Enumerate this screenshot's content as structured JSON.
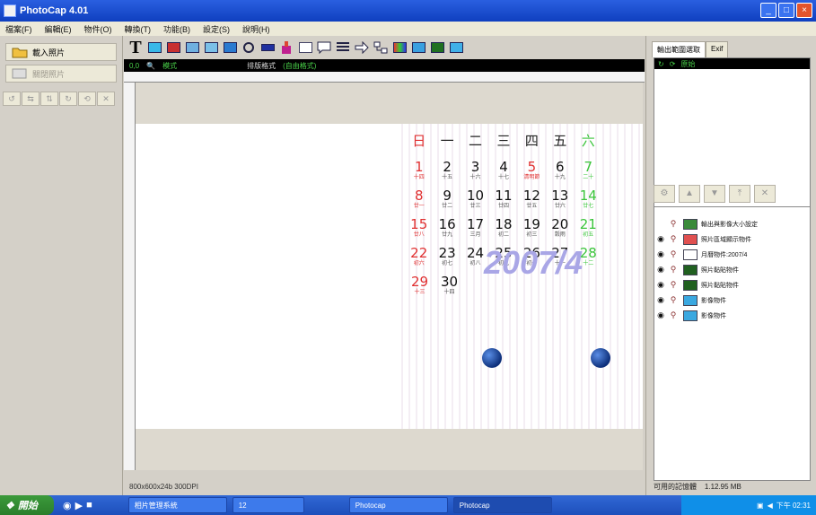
{
  "window": {
    "title": "PhotoCap 4.01"
  },
  "menu": [
    "檔案(F)",
    "編輯(E)",
    "物件(O)",
    "轉換(T)",
    "功能(B)",
    "設定(S)",
    "說明(H)"
  ],
  "left_panel": {
    "load_photo_label": "載入照片",
    "close_photo_label": "關閉照片"
  },
  "toolbar": {
    "text_tool": "T"
  },
  "status_bar": {
    "coords": "0,0",
    "mode": "模式",
    "format_label": "排版格式",
    "format_value": "(自由格式)"
  },
  "calendar": {
    "weekdays": [
      "日",
      "一",
      "二",
      "三",
      "四",
      "五",
      "六"
    ],
    "weeks": [
      [
        {
          "n": "1",
          "s": "十四"
        },
        {
          "n": "2",
          "s": "十五"
        },
        {
          "n": "3",
          "s": "十六"
        },
        {
          "n": "4",
          "s": "十七"
        },
        {
          "n": "5",
          "s": "清明節"
        },
        {
          "n": "6",
          "s": "十九"
        },
        {
          "n": "7",
          "s": "二十"
        }
      ],
      [
        {
          "n": "8",
          "s": "廿一"
        },
        {
          "n": "9",
          "s": "廿二"
        },
        {
          "n": "10",
          "s": "廿三"
        },
        {
          "n": "11",
          "s": "廿四"
        },
        {
          "n": "12",
          "s": "廿五"
        },
        {
          "n": "13",
          "s": "廿六"
        },
        {
          "n": "14",
          "s": "廿七"
        }
      ],
      [
        {
          "n": "15",
          "s": "廿八"
        },
        {
          "n": "16",
          "s": "廿九"
        },
        {
          "n": "17",
          "s": "三月"
        },
        {
          "n": "18",
          "s": "初二"
        },
        {
          "n": "19",
          "s": "初三"
        },
        {
          "n": "20",
          "s": "穀雨"
        },
        {
          "n": "21",
          "s": "初五"
        }
      ],
      [
        {
          "n": "22",
          "s": "初六"
        },
        {
          "n": "23",
          "s": "初七"
        },
        {
          "n": "24",
          "s": "初八"
        },
        {
          "n": "25",
          "s": "初九"
        },
        {
          "n": "26",
          "s": "初十"
        },
        {
          "n": "27",
          "s": "十一"
        },
        {
          "n": "28",
          "s": "十二"
        }
      ],
      [
        {
          "n": "29",
          "s": "十三"
        },
        {
          "n": "30",
          "s": "十四"
        }
      ]
    ],
    "year_month": "2007/4"
  },
  "dimensions_text": "800x600x24b 300DPI",
  "right_panel": {
    "tab_output": "輸出範圍選取",
    "tab_exif": "Exif",
    "output_status": "原始",
    "objects": [
      "輸出與影像大小設定",
      "照片區域顯示物件",
      "月曆物件:2007/4",
      "照片黏貼物件",
      "照片黏貼物件",
      "影像物件",
      "影像物件"
    ],
    "memory_label": "可用的記憶體",
    "memory_value": "1.12.95 MB"
  },
  "taskbar": {
    "start_label": "開始",
    "tasks": [
      "相片管理系統",
      "12",
      "Photocap",
      "Photocap"
    ],
    "clock": "下午 02:31"
  }
}
